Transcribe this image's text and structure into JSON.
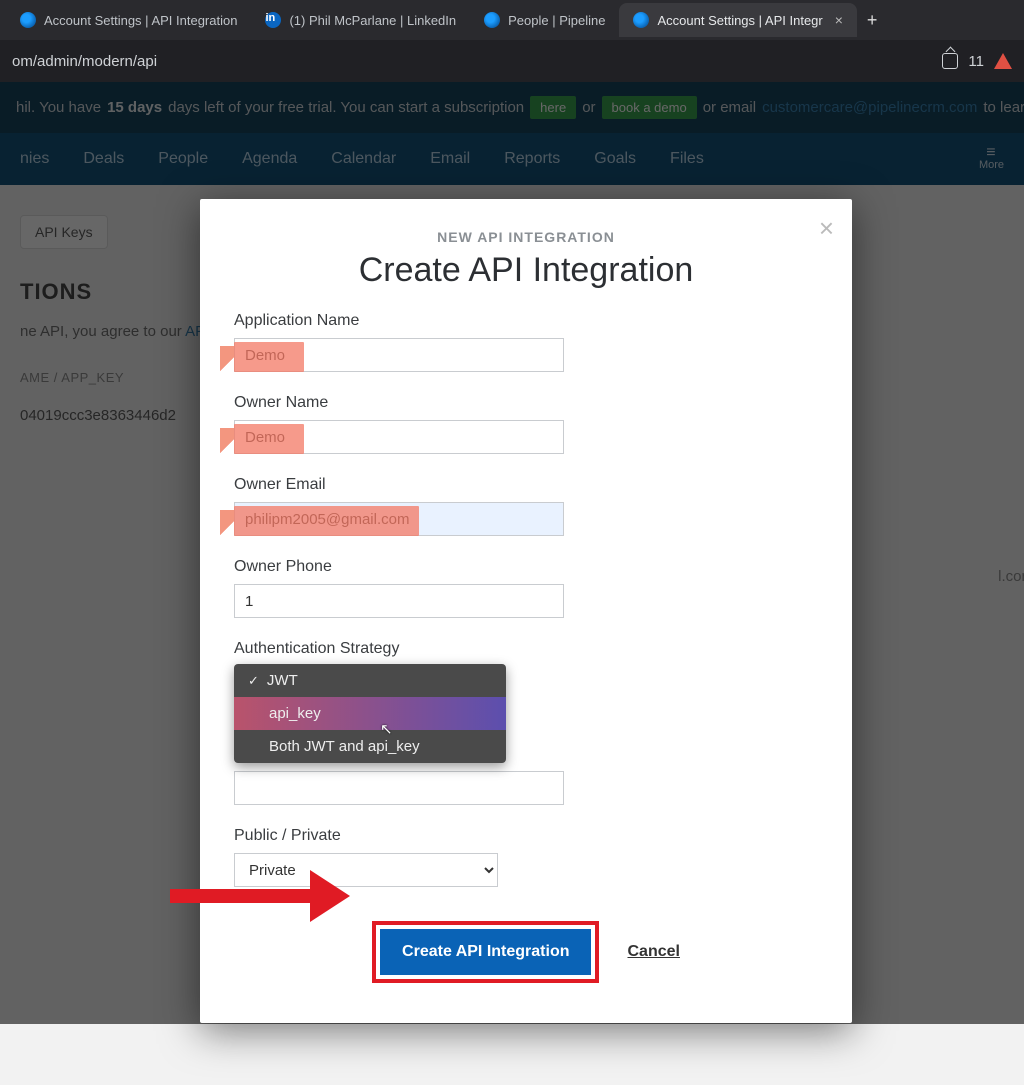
{
  "browser": {
    "tabs": [
      {
        "favicon": "pipeline",
        "title": "Account Settings | API Integration"
      },
      {
        "favicon": "linkedin",
        "title": "(1) Phil McParlane | LinkedIn"
      },
      {
        "favicon": "pipeline",
        "title": "People | Pipeline"
      },
      {
        "favicon": "pipeline",
        "title": "Account Settings | API Integr",
        "active": true
      }
    ],
    "url": "om/admin/modern/api",
    "shield_count": "11"
  },
  "trial": {
    "pre": "hil. You have ",
    "days": "15 days",
    "mid": " days left of your free trial. You can start a subscription ",
    "here": "here",
    "or1": " or ",
    "book": "book a demo",
    "or2": " or email ",
    "email": "customercare@pipelinecrm.com",
    "post": " to learn mo"
  },
  "nav": {
    "items": [
      "nies",
      "Deals",
      "People",
      "Agenda",
      "Calendar",
      "Email",
      "Reports",
      "Goals",
      "Files"
    ],
    "more": "More"
  },
  "page": {
    "tab": "API Keys",
    "heading": "TIONS",
    "agree_pre": "ne API, you agree to our ",
    "agree_link": "API Te",
    "col1": "AME / APP_KEY",
    "val1": "04019ccc3e8363446d2",
    "right_email": "l.com"
  },
  "modal": {
    "eyebrow": "NEW API INTEGRATION",
    "title": "Create API Integration",
    "fields": {
      "app_name": {
        "label": "Application Name",
        "value": "Demo"
      },
      "owner_name": {
        "label": "Owner Name",
        "value": "Demo"
      },
      "owner_email": {
        "label": "Owner Email",
        "value": "philipm2005@gmail.com"
      },
      "owner_phone": {
        "label": "Owner Phone",
        "value": "1"
      },
      "auth": {
        "label": "Authentication Strategy",
        "options": [
          "JWT",
          "api_key",
          "Both JWT and api_key"
        ],
        "selected_index": 1
      },
      "visibility": {
        "label": "Public / Private",
        "value": "Private"
      }
    },
    "submit": "Create API Integration",
    "cancel": "Cancel"
  }
}
